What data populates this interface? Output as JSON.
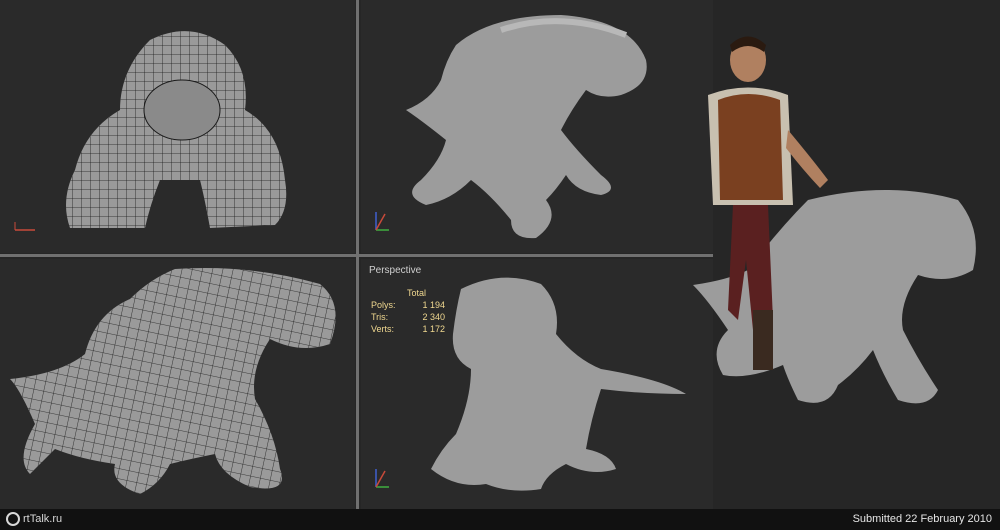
{
  "viewports": {
    "front": {
      "label": ""
    },
    "top_right": {
      "label": ""
    },
    "bottom_left": {
      "label": ""
    },
    "perspective": {
      "label": "Perspective"
    }
  },
  "stats": {
    "header": "Total",
    "rows": [
      {
        "label": "Polys:",
        "value": "1 194"
      },
      {
        "label": "Tris:",
        "value": "2 340"
      },
      {
        "label": "Verts:",
        "value": "1 172"
      }
    ]
  },
  "footer": {
    "logo_text": "rtTalk.ru",
    "submitted": "Submitted 22 February 2010"
  },
  "colors": {
    "background": "#262626",
    "viewport_bg": "#2a2a2a",
    "separator": "#707070",
    "stats_text": "#f0d890",
    "mesh_fill": "#9a9a9a",
    "mesh_lines": "#1a1a1a"
  },
  "icons": [
    "axis-gizmo-icon",
    "artalk-logo-icon"
  ]
}
